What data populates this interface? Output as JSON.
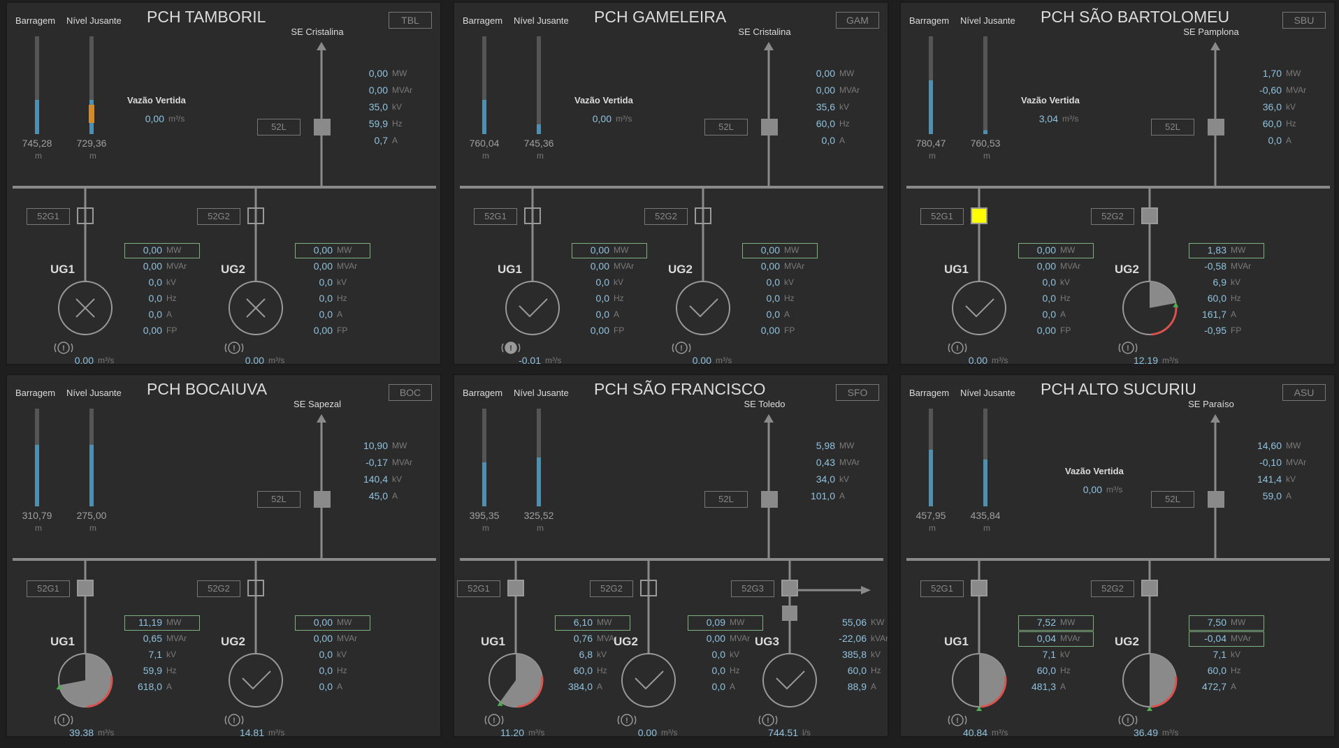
{
  "colors": {
    "background": "#2b2b2b",
    "value": "#8fc3e0",
    "line": "#8a8a8a",
    "alarm": "#ffff00",
    "arc_red": "#d9534f",
    "arc_green": "#4caf50",
    "box_green": "#7fb27f"
  },
  "common": {
    "barragem": "Barragem",
    "nivel_jusante": "Nível Jusante",
    "vazao_vertida": "Vazão Vertida",
    "m": "m",
    "m3s": "m³/s",
    "ls": "l/s",
    "52L": "52L",
    "u_mw": "MW",
    "u_mvar": "MVAr",
    "u_kv": "kV",
    "u_hz": "Hz",
    "u_a": "A",
    "u_fp": "FP",
    "u_kw": "KW",
    "u_kvar": "kVAr"
  },
  "panels": [
    {
      "title": "PCH TAMBORIL",
      "code": "TBL",
      "se": "SE Cristalina",
      "barragem": "745,28",
      "jusante": "729,36",
      "barragem_level": 0.35,
      "jusante_level": 0.35,
      "jusante_orange": true,
      "vazao": "0,00",
      "line": {
        "mw": "0,00",
        "mvar": "0,00",
        "kv": "35,0",
        "hz": "59,9",
        "a": "0,7"
      },
      "ugs": [
        {
          "name": "UG1",
          "breaker": "52G1",
          "mw": "0,00",
          "mvar": "0,00",
          "kv": "0,0",
          "hz": "0,0",
          "a": "0,0",
          "fp": "0,00",
          "flow": "0,00",
          "state": "x"
        },
        {
          "name": "UG2",
          "breaker": "52G2",
          "mw": "0,00",
          "mvar": "0,00",
          "kv": "0,0",
          "hz": "0,0",
          "a": "0,0",
          "fp": "0,00",
          "flow": "0,00",
          "state": "x"
        }
      ]
    },
    {
      "title": "PCH GAMELEIRA",
      "code": "GAM",
      "se": "SE Cristalina",
      "barragem": "760,04",
      "jusante": "745,36",
      "barragem_level": 0.35,
      "jusante_level": 0.1,
      "vazao": "0,00",
      "line": {
        "mw": "0,00",
        "mvar": "0,00",
        "kv": "35,6",
        "hz": "60,0",
        "a": "0,0"
      },
      "ugs": [
        {
          "name": "UG1",
          "breaker": "52G1",
          "mw": "0,00",
          "mvar": "0,00",
          "kv": "0,0",
          "hz": "0,0",
          "a": "0,0",
          "fp": "0,00",
          "flow": "-0,01",
          "state": "check",
          "alarm": true
        },
        {
          "name": "UG2",
          "breaker": "52G2",
          "mw": "0,00",
          "mvar": "0,00",
          "kv": "0,0",
          "hz": "0,0",
          "a": "0,0",
          "fp": "0,00",
          "flow": "0,00",
          "state": "check"
        }
      ]
    },
    {
      "title": "PCH SÃO BARTOLOMEU",
      "code": "SBU",
      "se": "SE Pamplona",
      "barragem": "780,47",
      "jusante": "760,53",
      "barragem_level": 0.55,
      "jusante_level": 0.04,
      "vazao": "3,04",
      "line": {
        "mw": "1,70",
        "mvar": "-0,60",
        "kv": "36,0",
        "hz": "60,0",
        "a": "0,0"
      },
      "ugs": [
        {
          "name": "UG1",
          "breaker": "52G1",
          "breaker_alarm": true,
          "mw": "0,00",
          "mvar": "0,00",
          "kv": "0,0",
          "hz": "0,0",
          "a": "0,0",
          "fp": "0,00",
          "flow": "0,00",
          "state": "check"
        },
        {
          "name": "UG2",
          "breaker": "52G2",
          "breaker_filled": true,
          "mw": "1,83",
          "mvar": "-0,58",
          "kv": "6,9",
          "hz": "60,0",
          "a": "161,7",
          "fp": "-0,95",
          "flow": "12,19",
          "state": "gauge",
          "gauge": 0.22
        }
      ]
    },
    {
      "title": "PCH BOCAIUVA",
      "code": "BOC",
      "se": "SE Sapezal",
      "barragem": "310,79",
      "jusante": "275,00",
      "barragem_level": 0.63,
      "jusante_level": 0.63,
      "line": {
        "mw": "10,90",
        "mvar": "-0,17",
        "kv": "140,4",
        "a": "45,0"
      },
      "ugs": [
        {
          "name": "UG1",
          "breaker": "52G1",
          "breaker_filled": true,
          "mw": "11,19",
          "mvar": "0,65",
          "kv": "7,1",
          "hz": "59,9",
          "a": "618,0",
          "flow": "39,38",
          "state": "gauge",
          "gauge": 0.72
        },
        {
          "name": "UG2",
          "breaker": "52G2",
          "mw": "0,00",
          "mvar": "0,00",
          "kv": "0,0",
          "hz": "0,0",
          "a": "0,0",
          "flow": "14,81",
          "state": "check"
        }
      ]
    },
    {
      "title": "PCH SÃO FRANCISCO",
      "code": "SFO",
      "se": "SE Toledo",
      "barragem": "395,35",
      "jusante": "325,52",
      "barragem_level": 0.45,
      "jusante_level": 0.5,
      "line": {
        "mw": "5,98",
        "mvar": "0,43",
        "kv": "34,0",
        "a": "101,0"
      },
      "ugs": [
        {
          "name": "UG1",
          "breaker": "52G1",
          "breaker_filled": true,
          "mw": "6,10",
          "mvar": "0,76",
          "kv": "6,8",
          "hz": "60,0",
          "a": "384,0",
          "flow": "11,20",
          "state": "gauge",
          "gauge": 0.6
        },
        {
          "name": "UG2",
          "breaker": "52G2",
          "mw": "0,09",
          "mvar": "0,00",
          "kv": "0,0",
          "hz": "0,0",
          "a": "0,0",
          "flow": "0,00",
          "state": "check"
        },
        {
          "name": "UG3",
          "breaker": "52G3",
          "breaker_filled": true,
          "mw": "55,06",
          "mvar": "-22,06",
          "kv": "385,8",
          "hz": "60,0",
          "a": "88,9",
          "flow": "744,51",
          "flow_unit": "l/s",
          "state": "check",
          "kw": true
        }
      ]
    },
    {
      "title": "PCH ALTO SUCURIU",
      "code": "ASU",
      "se": "SE Paraíso",
      "barragem": "457,95",
      "jusante": "435,84",
      "barragem_level": 0.58,
      "jusante_level": 0.48,
      "vazao": "0,00",
      "vazao_low": true,
      "line": {
        "mw": "14,60",
        "mvar": "-0,10",
        "kv": "141,4",
        "a": "59,0"
      },
      "ugs": [
        {
          "name": "UG1",
          "breaker": "52G1",
          "breaker_filled": true,
          "mw": "7,52",
          "mvar": "0,04",
          "kv": "7,1",
          "hz": "60,0",
          "a": "481,3",
          "flow": "40,84",
          "state": "gauge",
          "gauge": 0.5,
          "mvar_box": true
        },
        {
          "name": "UG2",
          "breaker": "52G2",
          "breaker_filled": true,
          "mw": "7,50",
          "mvar": "-0,04",
          "kv": "7,1",
          "hz": "60,0",
          "a": "472,7",
          "flow": "36,49",
          "state": "gauge",
          "gauge": 0.5,
          "mvar_box": true
        }
      ]
    }
  ]
}
